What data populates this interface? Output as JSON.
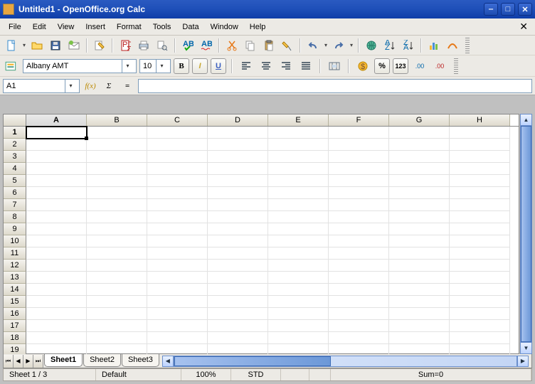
{
  "window": {
    "title": "Untitled1 - OpenOffice.org Calc"
  },
  "menu": {
    "file": "File",
    "edit": "Edit",
    "view": "View",
    "insert": "Insert",
    "format": "Format",
    "tools": "Tools",
    "data": "Data",
    "window": "Window",
    "help": "Help"
  },
  "formatting": {
    "font_name": "Albany AMT",
    "font_size": "10",
    "bold": "B",
    "italic": "I",
    "underline": "U",
    "percent": "%",
    "decimal_btn": "123",
    "add_dec": ".00",
    "rem_dec": ".00"
  },
  "formula": {
    "name_box": "A1",
    "fx": "f(x)",
    "sigma": "Σ",
    "equals": "=",
    "input": ""
  },
  "grid": {
    "columns": [
      "A",
      "B",
      "C",
      "D",
      "E",
      "F",
      "G",
      "H"
    ],
    "rows": [
      "1",
      "2",
      "3",
      "4",
      "5",
      "6",
      "7",
      "8",
      "9",
      "10",
      "11",
      "12",
      "13",
      "14",
      "15",
      "16",
      "17",
      "18",
      "19"
    ],
    "active_cell": "A1"
  },
  "sheets": {
    "items": [
      "Sheet1",
      "Sheet2",
      "Sheet3"
    ],
    "active": 0
  },
  "status": {
    "sheet_pos": "Sheet 1 / 3",
    "style": "Default",
    "zoom": "100%",
    "mode": "STD",
    "sum": "Sum=0"
  }
}
